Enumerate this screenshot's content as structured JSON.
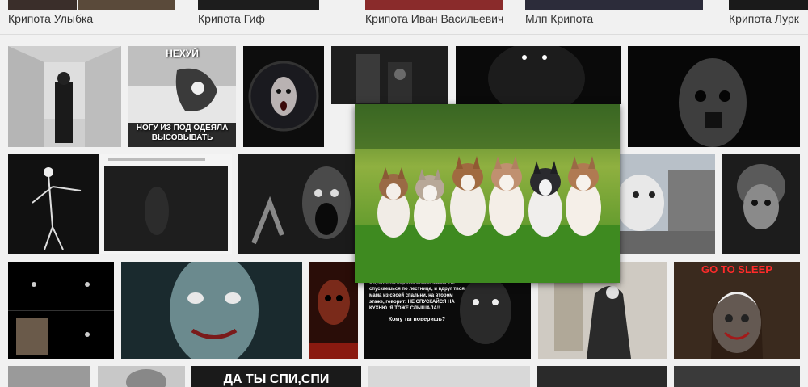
{
  "related_searches": [
    {
      "label": "Крипота Улыбка"
    },
    {
      "label": "Крипота Гиф"
    },
    {
      "label": "Крипота Иван Васильевич"
    },
    {
      "label": "Млп Крипота"
    },
    {
      "label": "Крипота Лурк"
    }
  ],
  "tiles": {
    "neхui_caption_top": "НЕХУЙ",
    "neхui_caption_bottom": "НОГУ ИЗ ПОД ОДЕЯЛА ВЫСОВЫВАТЬ",
    "story_text": "Однажды сидишь ты у себя в комнате на втором этаже, как вдруг зовет тебя с кухни, на первом этаже, мама. Ты спускаешься по лестнице, и вдруг твоя мама из своей спальни, на втором этаже, говорит: НЕ СПУСКАЙСЯ НА КУХНЮ. Я ТОЖЕ СЛЫШАЛА!!",
    "story_question": "Кому ты поверишь?",
    "go_to_sleep": "GO TO SLEEP",
    "bottom_caption": "ДА ТЫ СПИ,СПИ"
  },
  "preview": {
    "subject": "six husky puppies sitting on grass"
  },
  "colors": {
    "page_bg": "#f1f1f1",
    "go_to_sleep": "#ff2a2a"
  }
}
